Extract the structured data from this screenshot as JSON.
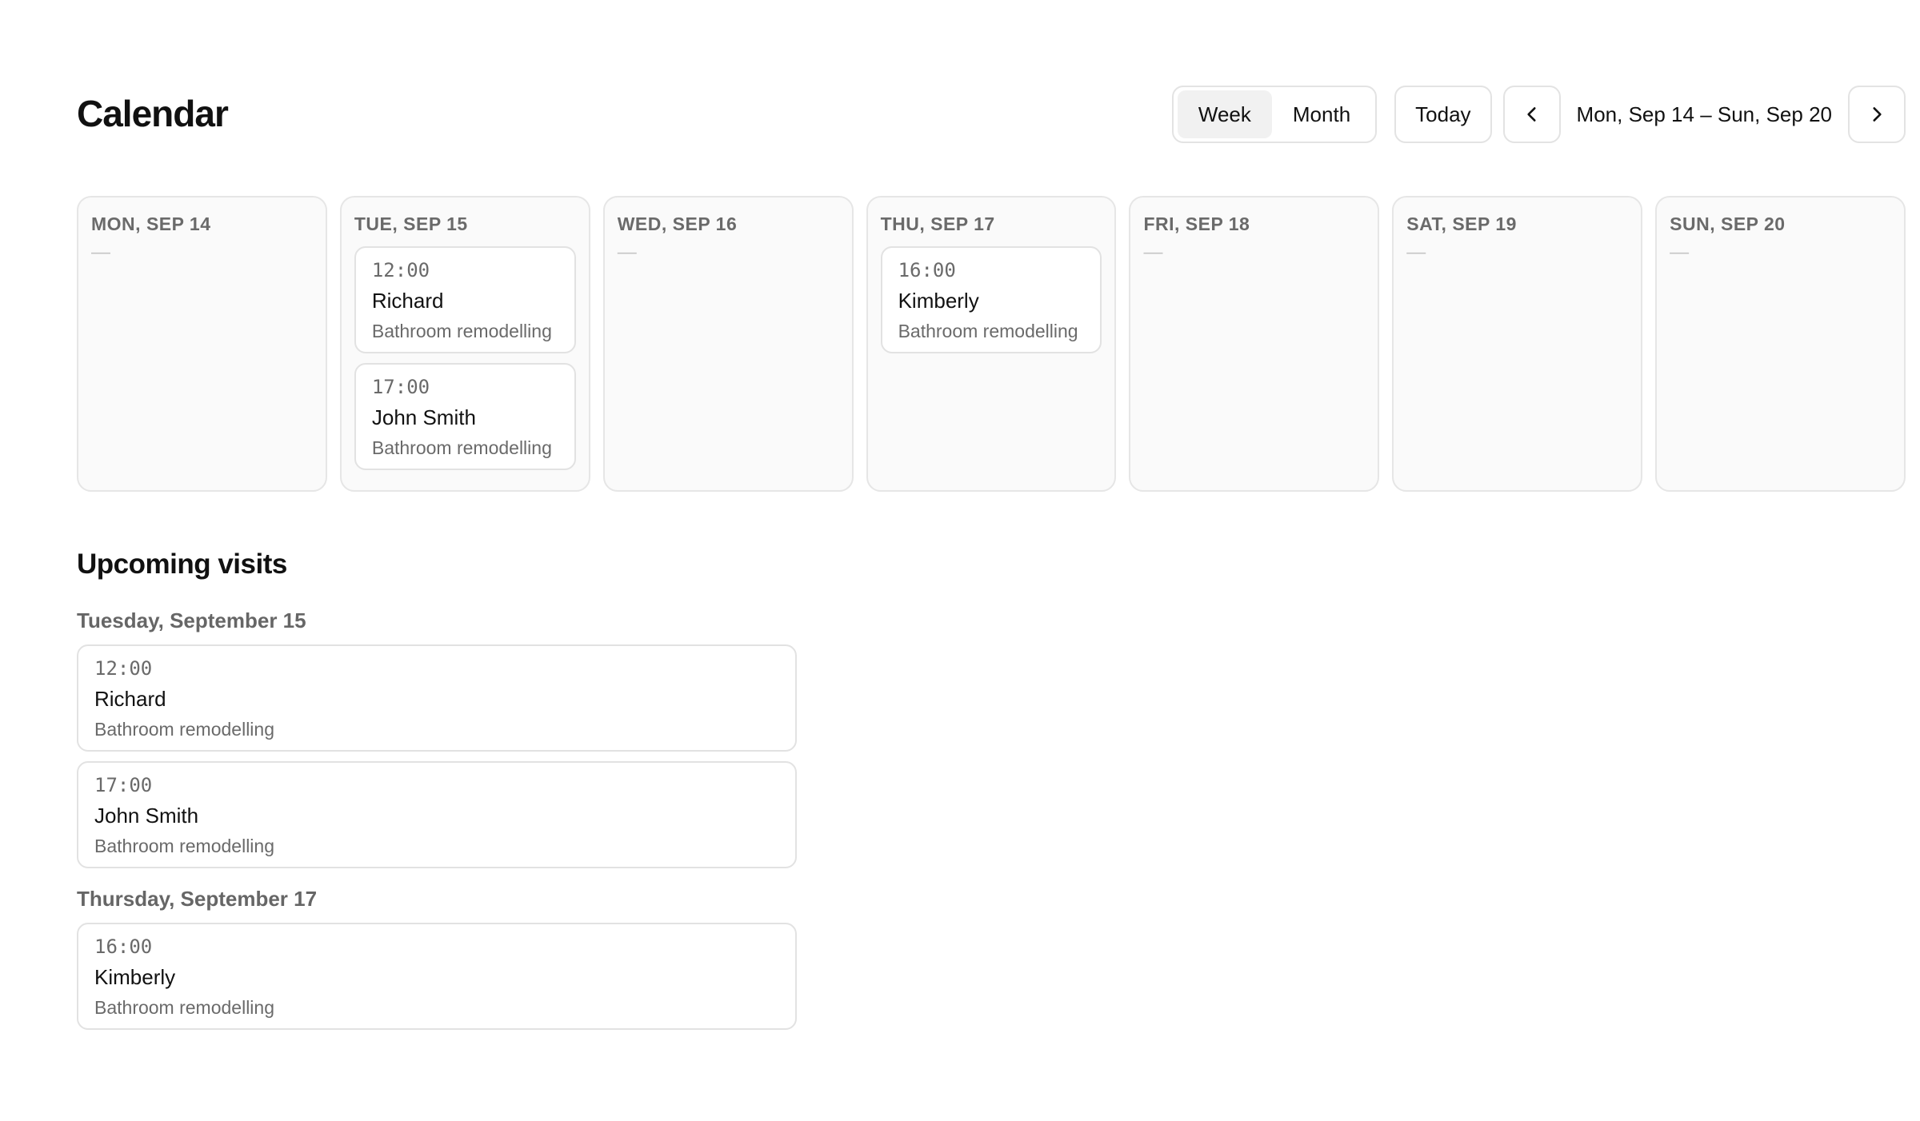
{
  "header": {
    "title": "Calendar",
    "view_toggle": [
      {
        "label": "Week",
        "active": true
      },
      {
        "label": "Month",
        "active": false
      }
    ],
    "today_label": "Today",
    "prev_icon": "chevron-left-icon",
    "next_icon": "chevron-right-icon",
    "range_label": "Mon, Sep 14 – Sun, Sep 20"
  },
  "week": {
    "empty_placeholder": "—",
    "days": [
      {
        "label": "MON, SEP 14",
        "events": []
      },
      {
        "label": "TUE, SEP 15",
        "events": [
          {
            "time": "12:00",
            "name": "Richard",
            "desc": "Bathroom remodelling"
          },
          {
            "time": "17:00",
            "name": "John Smith",
            "desc": "Bathroom remodelling"
          }
        ]
      },
      {
        "label": "WED, SEP 16",
        "events": []
      },
      {
        "label": "THU, SEP 17",
        "events": [
          {
            "time": "16:00",
            "name": "Kimberly",
            "desc": "Bathroom remodelling"
          }
        ]
      },
      {
        "label": "FRI, SEP 18",
        "events": []
      },
      {
        "label": "SAT, SEP 19",
        "events": []
      },
      {
        "label": "SUN, SEP 20",
        "events": []
      }
    ]
  },
  "upcoming": {
    "title": "Upcoming visits",
    "groups": [
      {
        "date": "Tuesday, September 15",
        "visits": [
          {
            "time": "12:00",
            "name": "Richard",
            "desc": "Bathroom remodelling"
          },
          {
            "time": "17:00",
            "name": "John Smith",
            "desc": "Bathroom remodelling"
          }
        ]
      },
      {
        "date": "Thursday, September 17",
        "visits": [
          {
            "time": "16:00",
            "name": "Kimberly",
            "desc": "Bathroom remodelling"
          }
        ]
      }
    ]
  }
}
